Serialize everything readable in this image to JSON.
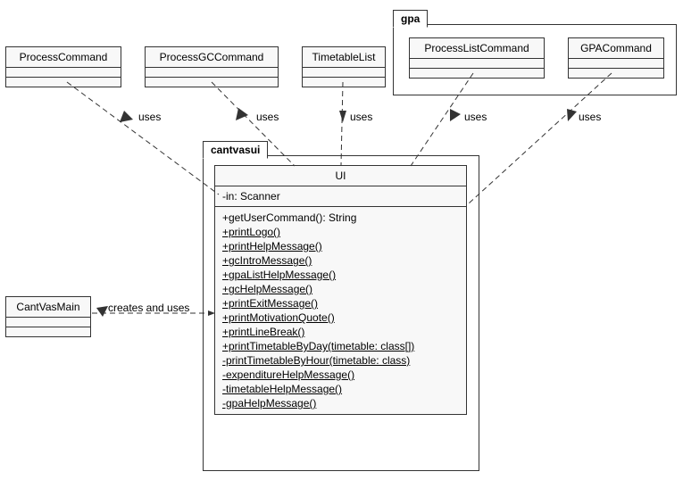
{
  "packages": {
    "gpa": {
      "label": "gpa"
    },
    "cantvasui": {
      "label": "cantvasui"
    }
  },
  "classes": {
    "processCommand": {
      "name": "ProcessCommand"
    },
    "processGCCommand": {
      "name": "ProcessGCCommand"
    },
    "timetableList": {
      "name": "TimetableList"
    },
    "processListCommand": {
      "name": "ProcessListCommand"
    },
    "gpaCommand": {
      "name": "GPACommand"
    },
    "cantVasMain": {
      "name": "CantVasMain"
    },
    "ui": {
      "name": "UI",
      "attr": "-in: Scanner",
      "methods": [
        "+getUserCommand(): String",
        "+printLogo()",
        "+printHelpMessage()",
        "+gcIntroMessage()",
        "+gpaListHelpMessage()",
        "+gcHelpMessage()",
        "+printExitMessage()",
        "+printMotivationQuote()",
        "+printLineBreak()",
        "+printTimetableByDay(timetable: class[])",
        "-printTimetableByHour(timetable: class)",
        "-expenditureHelpMessage()",
        "-timetableHelpMessage()",
        "-gpaHelpMessage()"
      ]
    }
  },
  "edges": {
    "uses": "uses",
    "createsAndUses": "creates and uses"
  }
}
